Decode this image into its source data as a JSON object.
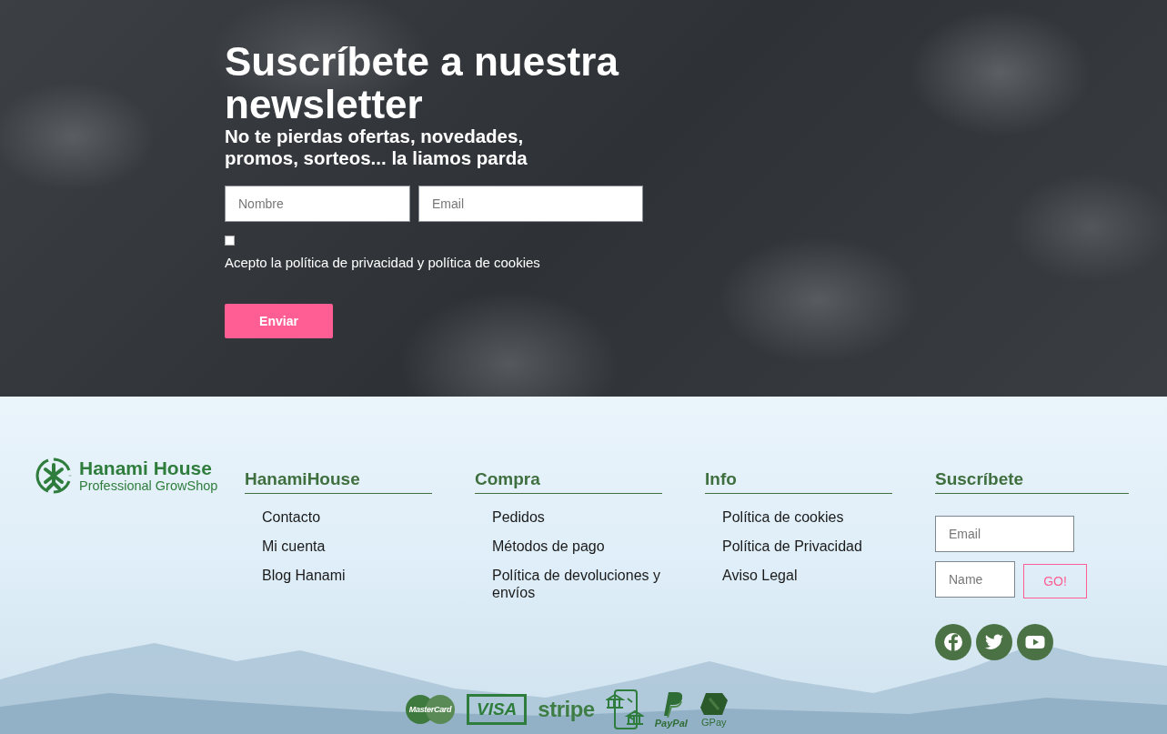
{
  "newsletter": {
    "title": "Suscríbete a nuestra newsletter",
    "subtitle": "No te pierdas ofertas, novedades, promos, sorteos... la liamos parda",
    "fields": [
      {
        "placeholder": "Nombre"
      },
      {
        "placeholder": "Email"
      }
    ],
    "consent": {
      "checked": false,
      "label": "Acepto la política de privacidad y política de cookies"
    },
    "submit": "Enviar"
  },
  "footer": {
    "logo": {
      "name": "Hanami House",
      "tagline": "Professional GrowShop"
    },
    "columns": [
      {
        "heading": "HanamiHouse",
        "links": [
          "Contacto",
          "Mi cuenta",
          "Blog Hanami"
        ]
      },
      {
        "heading": "Compra",
        "links": [
          "Pedidos",
          "Métodos de pago",
          "Política de devoluciones y envíos"
        ]
      },
      {
        "heading": "Info",
        "links": [
          "Política de cookies",
          "Política de Privacidad",
          "Aviso Legal"
        ]
      }
    ],
    "subscribe": {
      "heading": "Suscríbete",
      "email_placeholder": "Email",
      "name_placeholder": "Name",
      "button": "GO!",
      "social": [
        {
          "kind": "facebook"
        },
        {
          "kind": "twitter"
        },
        {
          "kind": "youtube"
        }
      ]
    },
    "payments": [
      {
        "kind": "mastercard",
        "label": "MasterCard"
      },
      {
        "kind": "visa",
        "label": "VISA"
      },
      {
        "kind": "stripe",
        "label": "stripe"
      },
      {
        "kind": "bank"
      },
      {
        "kind": "paypal",
        "label": "PayPal"
      },
      {
        "kind": "gpay",
        "label": "GPay"
      }
    ]
  }
}
